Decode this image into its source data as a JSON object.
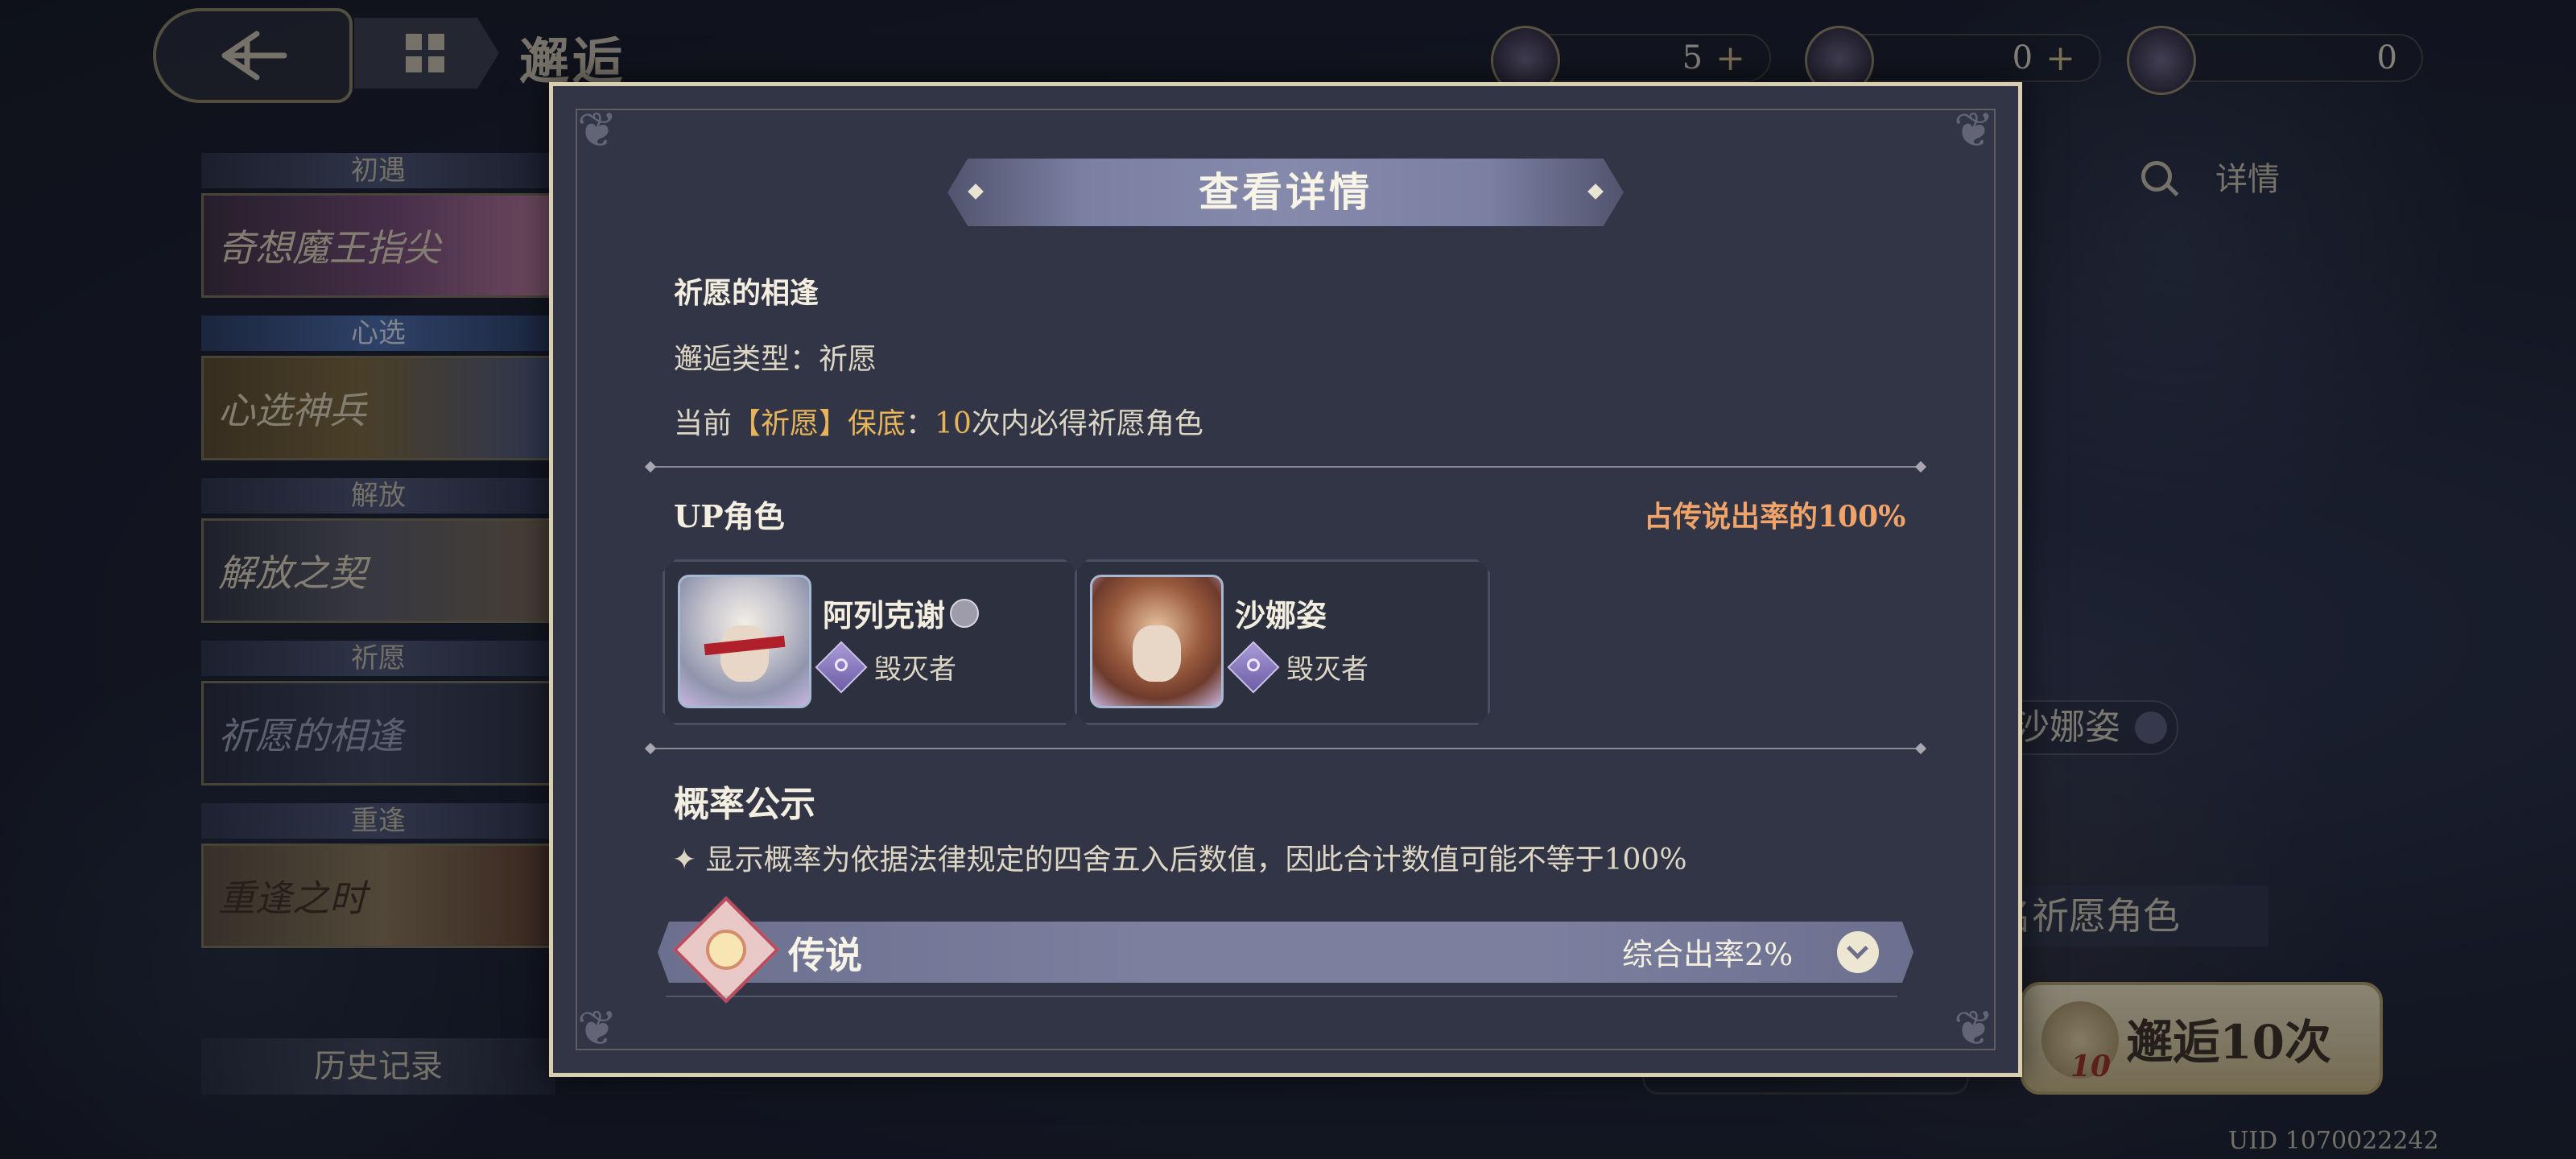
{
  "background": {
    "page_title": "邂逅",
    "resources": [
      {
        "icon": "compass-star-icon",
        "value": "5",
        "has_plus": true
      },
      {
        "icon": "orb-icon",
        "value": "0",
        "has_plus": true
      },
      {
        "icon": "crest-icon",
        "value": "0",
        "has_plus": false
      }
    ],
    "detail_link": "详情",
    "sidebar": [
      {
        "head": "初遇",
        "banner": "奇想魔王指尖"
      },
      {
        "head": "心选",
        "banner": "心选神兵"
      },
      {
        "head": "解放",
        "banner": "解放之契"
      },
      {
        "head": "祈愿",
        "banner": "祈愿的相逢"
      },
      {
        "head": "重逢",
        "banner": "重逢之时"
      }
    ],
    "history": "历史记录",
    "character_tag": "沙娜姿",
    "wish_line": "名祈愿角色",
    "draw10_label": "邂逅10次",
    "draw10_count": "10",
    "uid": "UID 1070022242"
  },
  "modal": {
    "title": "查看详情",
    "banner_name": "祈愿的相逢",
    "type_line": "邂逅类型：祈愿",
    "guarantee": {
      "prefix": "当前",
      "tag": "【祈愿】保底",
      "colon": "：",
      "count": "10",
      "suffix": "次内必得祈愿角色"
    },
    "up_section": {
      "title": "UP角色",
      "rate": "占传说出率的100%",
      "characters": [
        {
          "name": "阿列克谢",
          "role": "毁灭者",
          "has_badge": true
        },
        {
          "name": "沙娜姿",
          "role": "毁灭者",
          "has_badge": false
        }
      ]
    },
    "prob_section": {
      "title": "概率公示",
      "note": "✦ 显示概率为依据法律规定的四舍五入后数值，因此合计数值可能不等于100%"
    },
    "tiers": [
      {
        "name": "传说",
        "rate": "综合出率2%"
      }
    ]
  }
}
